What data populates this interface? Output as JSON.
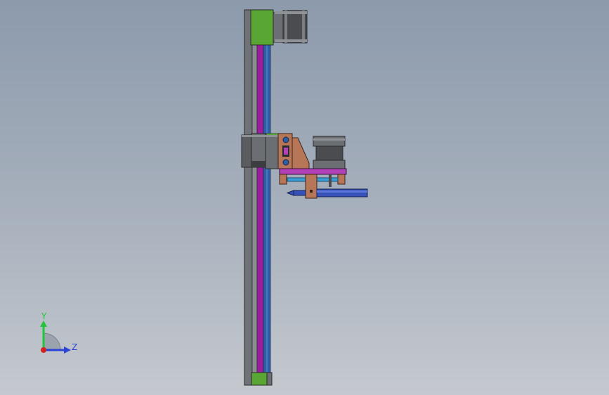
{
  "viewport": {
    "background_top": "#8c9aac",
    "background_bottom": "#c5c9cf"
  },
  "model": {
    "colors": {
      "rail_frame": "#6f7277",
      "rail_purple": "#9e1c9e",
      "rail_blue": "#2e5fa6",
      "end_block_green": "#59a634",
      "motor_dark": "#4a4c50",
      "motor_mid": "#6b6e72",
      "bracket_brown": "#b87659",
      "platform_magenta": "#b142b8",
      "cylinder_blue": "#3651b8",
      "mini_rail_blue": "#3aa0d8"
    }
  },
  "triad": {
    "y_label": "Y",
    "z_label": "Z",
    "y_color": "#22c43b",
    "z_color": "#2b44d6",
    "x_color": "#d32020",
    "icon": "coordinate-axes-icon"
  }
}
